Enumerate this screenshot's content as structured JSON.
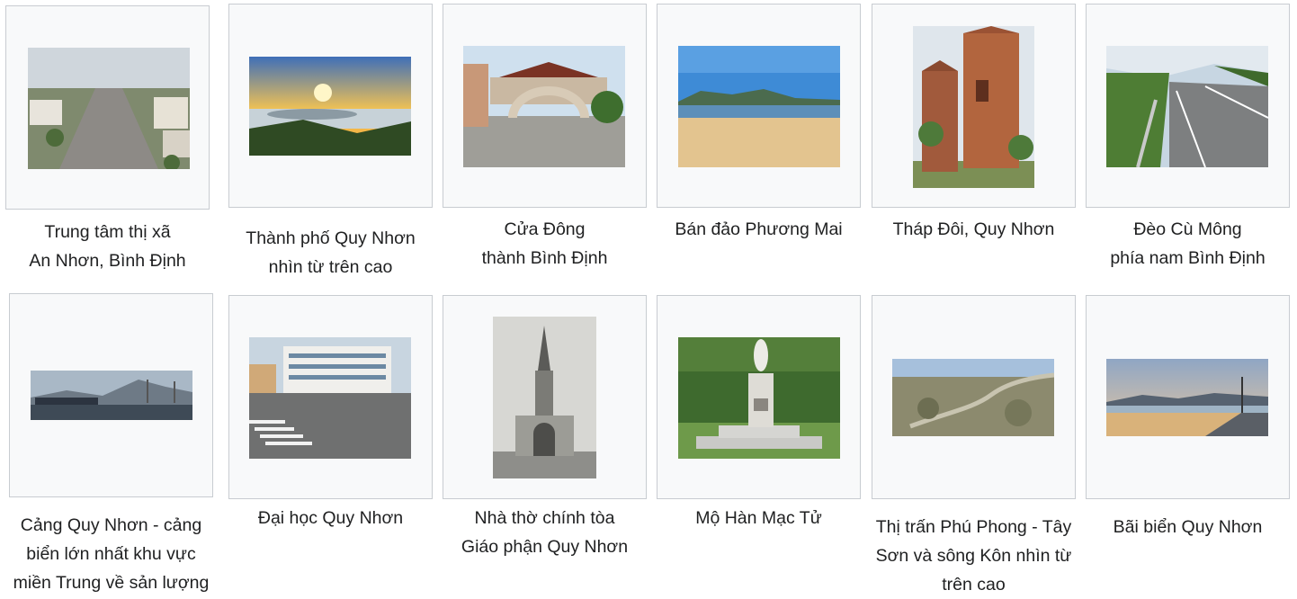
{
  "gallery": {
    "items": [
      {
        "name": "an-nhon-center",
        "caption": [
          "Trung tâm thị xã",
          "An Nhơn, Bình Định"
        ],
        "scene": "town"
      },
      {
        "name": "quy-nhon-aerial",
        "caption": [
          "Thành phố Quy Nhơn",
          "nhìn từ trên cao"
        ],
        "scene": "sunset"
      },
      {
        "name": "cua-dong",
        "caption": [
          "Cửa Đông",
          "thành Bình Định"
        ],
        "scene": "gate"
      },
      {
        "name": "phuong-mai",
        "caption": [
          "Bán đảo Phương Mai"
        ],
        "scene": "beach"
      },
      {
        "name": "thap-doi",
        "caption": [
          "Tháp Đôi, Quy Nhơn"
        ],
        "scene": "towers"
      },
      {
        "name": "deo-cu-mong",
        "caption": [
          "Đèo Cù Mông",
          "phía nam Bình Định"
        ],
        "scene": "road"
      },
      {
        "name": "cang-quy-nhon",
        "caption": [
          "Cảng Quy Nhơn - cảng",
          "biển lớn nhất khu vực",
          "miền Trung về sản lượng"
        ],
        "scene": "port"
      },
      {
        "name": "dai-hoc-quy-nhon",
        "caption": [
          "Đại học Quy Nhơn"
        ],
        "scene": "university"
      },
      {
        "name": "nha-tho",
        "caption": [
          "Nhà thờ chính tòa",
          "Giáo phận Quy Nhơn"
        ],
        "scene": "church"
      },
      {
        "name": "mo-han-mac-tu",
        "caption": [
          "Mộ Hàn Mạc Tử"
        ],
        "scene": "tomb"
      },
      {
        "name": "phu-phong",
        "caption": [
          "Thị trấn Phú Phong - Tây",
          "Sơn và sông Kôn nhìn từ",
          "trên cao"
        ],
        "scene": "aerial"
      },
      {
        "name": "bai-bien",
        "caption": [
          "Bãi biển Quy Nhơn"
        ],
        "scene": "promenade"
      }
    ]
  }
}
